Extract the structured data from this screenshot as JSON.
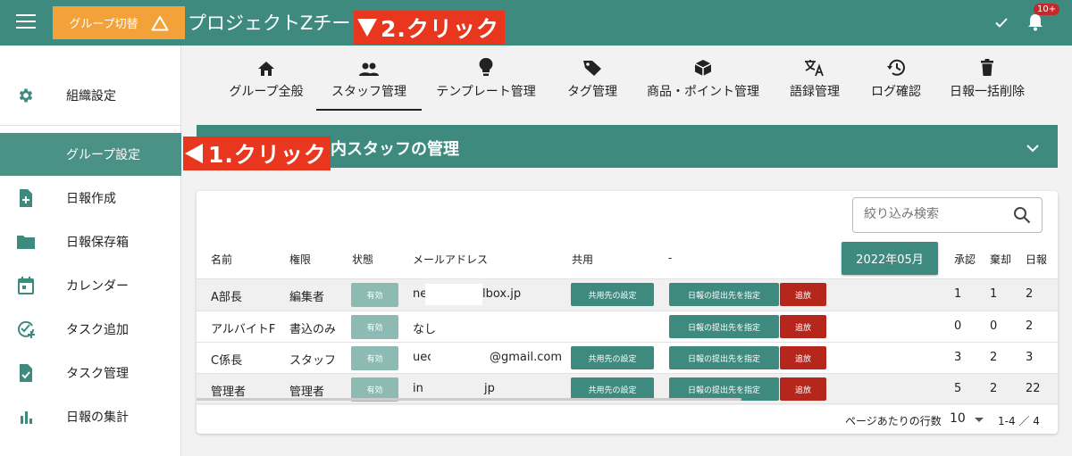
{
  "header": {
    "group_switch_label": "グループ切替",
    "project_title": "プロジェクトZチー",
    "notification_badge": "10+"
  },
  "annotations": {
    "step2": "2.クリック",
    "step1": "1.クリック"
  },
  "sidebar": {
    "items": [
      {
        "label": "組織設定",
        "icon": "gear-icon"
      },
      {
        "label": "グループ設定",
        "icon": "none"
      },
      {
        "label": "日報作成",
        "icon": "document-add-icon"
      },
      {
        "label": "日報保存箱",
        "icon": "folder-icon"
      },
      {
        "label": "カレンダー",
        "icon": "calendar-icon"
      },
      {
        "label": "タスク追加",
        "icon": "task-add-icon"
      },
      {
        "label": "タスク管理",
        "icon": "task-check-icon"
      },
      {
        "label": "日報の集計",
        "icon": "bar-chart-icon"
      }
    ]
  },
  "tabs": [
    {
      "label": "グループ全般",
      "icon": "home-icon"
    },
    {
      "label": "スタッフ管理",
      "icon": "people-icon"
    },
    {
      "label": "テンプレート管理",
      "icon": "lightbulb-icon"
    },
    {
      "label": "タグ管理",
      "icon": "tag-icon"
    },
    {
      "label": "商品・ポイント管理",
      "icon": "box-icon"
    },
    {
      "label": "語録管理",
      "icon": "translate-icon"
    },
    {
      "label": "ログ確認",
      "icon": "history-icon"
    },
    {
      "label": "日報一括削除",
      "icon": "trash-icon"
    }
  ],
  "section": {
    "title": "内スタッフの管理"
  },
  "staff_table": {
    "search_placeholder": "絞り込み検索",
    "month_button": "2022年05月",
    "headers": {
      "name": "名前",
      "role": "権限",
      "status": "状態",
      "email": "メールアドレス",
      "share": "共用",
      "dash": "-",
      "approve": "承認",
      "reject": "棄却",
      "report": "日報"
    },
    "rows": [
      {
        "name": "A部長",
        "role": "編集者",
        "status": "有効",
        "email_start": "ne",
        "email_end": "lbox.jp",
        "share_button": "共用先の設定",
        "dest_button": "日報の提出先を指定",
        "kick_button": "追放",
        "approve": "1",
        "reject": "1",
        "report": "2"
      },
      {
        "name": "アルバイトF",
        "role": "書込のみ",
        "status": "有効",
        "email_start": "なし",
        "email_end": "",
        "share_button": "",
        "dest_button": "日報の提出先を指定",
        "kick_button": "追放",
        "approve": "0",
        "reject": "0",
        "report": "2"
      },
      {
        "name": "C係長",
        "role": "スタッフ",
        "status": "有効",
        "email_start": "uec",
        "email_end": "@gmail.com",
        "share_button": "共用先の設定",
        "dest_button": "日報の提出先を指定",
        "kick_button": "追放",
        "approve": "3",
        "reject": "2",
        "report": "3"
      },
      {
        "name": "管理者",
        "role": "管理者",
        "status": "有効",
        "email_start": "in",
        "email_end": "jp",
        "share_button": "共用先の設定",
        "dest_button": "日報の提出先を指定",
        "kick_button": "追放",
        "approve": "5",
        "reject": "2",
        "report": "22"
      }
    ],
    "pagination": {
      "rows_per_page_label": "ページあたりの行数",
      "rows_per_page_value": "10",
      "range": "1-4 ／ 4"
    }
  },
  "colors": {
    "primary": "#3f8a7f",
    "accent_orange": "#f3a23a",
    "annotation_red": "#e8371e",
    "danger": "#b5271d"
  }
}
